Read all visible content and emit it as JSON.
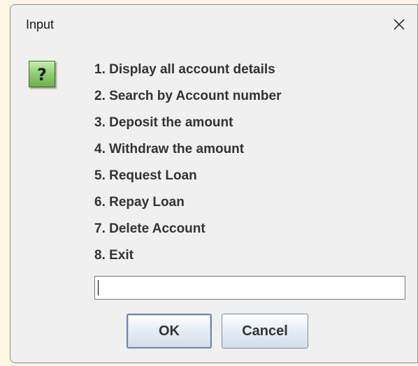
{
  "dialog": {
    "title": "Input",
    "close_label": "close",
    "icon": "question-icon",
    "icon_glyph": "?",
    "options": [
      "1. Display all account details",
      "2. Search by Account number",
      "3. Deposit the amount",
      "4. Withdraw the amount",
      "5. Request Loan",
      "6. Repay Loan",
      "7. Delete Account",
      "8. Exit"
    ],
    "input": {
      "value": "",
      "placeholder": ""
    },
    "buttons": {
      "ok": "OK",
      "cancel": "Cancel"
    }
  },
  "colors": {
    "dialog_bg": "#f0f0f0",
    "page_bg": "#fdf6e3",
    "icon_green": "#8fcd72",
    "text": "#333333"
  }
}
